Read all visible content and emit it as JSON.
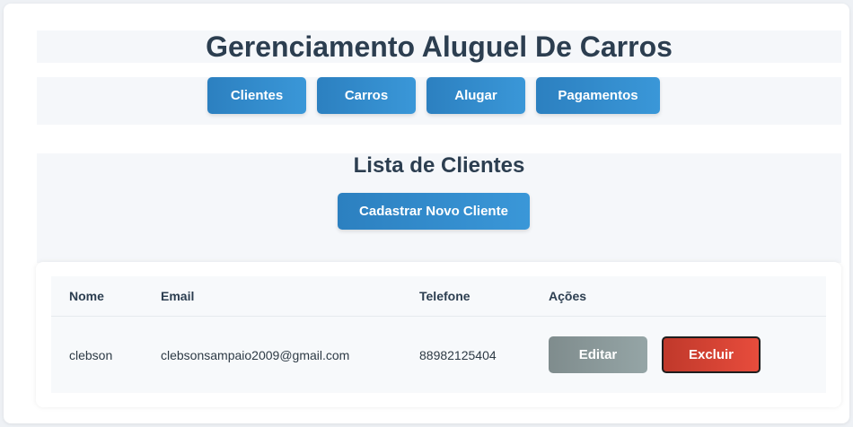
{
  "header": {
    "title": "Gerenciamento Aluguel De Carros"
  },
  "nav": {
    "items": [
      {
        "label": "Clientes"
      },
      {
        "label": "Carros"
      },
      {
        "label": "Alugar"
      },
      {
        "label": "Pagamentos"
      }
    ]
  },
  "clients_section": {
    "title": "Lista de Clientes",
    "new_button_label": "Cadastrar Novo Cliente"
  },
  "table": {
    "columns": [
      "Nome",
      "Email",
      "Telefone",
      "Ações"
    ],
    "rows": [
      {
        "nome": "clebson",
        "email": "clebsonsampaio2009@gmail.com",
        "telefone": "88982125404",
        "edit_label": "Editar",
        "delete_label": "Excluir"
      }
    ]
  },
  "colors": {
    "primary": "#3498db",
    "primary_dark": "#2c80c0",
    "heading": "#2c3e50",
    "edit": "#95a5a6",
    "delete": "#e74c3c",
    "panel": "#f5f7fa"
  }
}
